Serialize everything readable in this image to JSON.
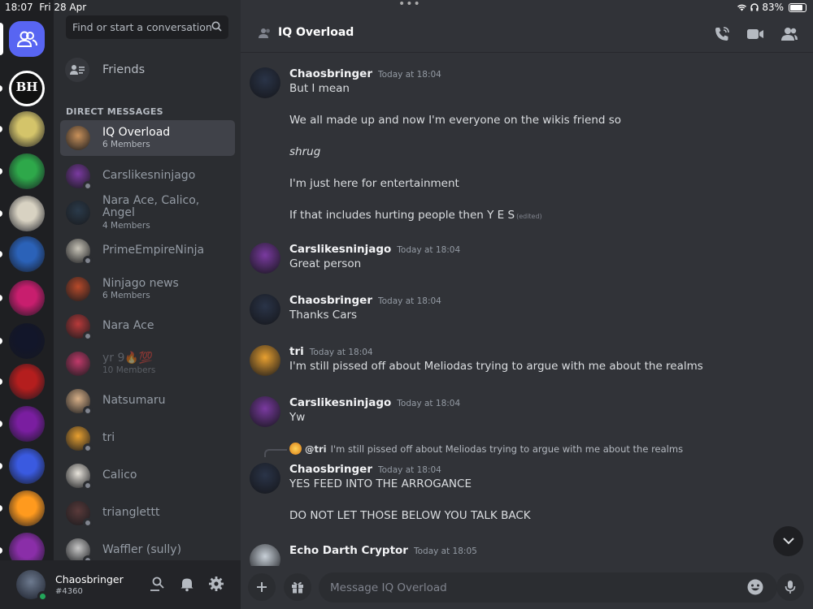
{
  "status_bar": {
    "time": "18:07",
    "date": "Fri 28 Apr",
    "battery": "83%",
    "battery_fraction": 0.83
  },
  "servers": [
    {
      "name": "server-bh",
      "color": "#ffffff"
    },
    {
      "name": "server-2",
      "color": "#d4c46a"
    },
    {
      "name": "server-3",
      "color": "#2ea84a"
    },
    {
      "name": "server-4",
      "color": "#d8d2c2"
    },
    {
      "name": "server-5",
      "color": "#2b62b8"
    },
    {
      "name": "server-6",
      "color": "#c81e6e"
    },
    {
      "name": "server-7",
      "color": "#12162a"
    },
    {
      "name": "server-8",
      "color": "#b41e1e"
    },
    {
      "name": "server-9",
      "color": "#7a1ea0"
    },
    {
      "name": "server-10",
      "color": "#3a5ae0"
    },
    {
      "name": "server-11",
      "color": "#ff9a1e"
    },
    {
      "name": "server-12",
      "color": "#8a2ea8"
    }
  ],
  "bh_label": "BH",
  "search": {
    "placeholder": "Find or start a conversation"
  },
  "friends_label": "Friends",
  "dm_header": "DIRECT MESSAGES",
  "dms": [
    {
      "name": "IQ Overload",
      "sub": "6 Members",
      "active": true,
      "color": "#c9915a"
    },
    {
      "name": "Carslikesninjago",
      "sub": "",
      "color": "#7a3aa0"
    },
    {
      "name": "Nara Ace, Calico, Angel",
      "sub": "4 Members",
      "color": "#2a3a4a"
    },
    {
      "name": "PrimeEmpireNinja",
      "sub": "",
      "color": "#c8c4b8"
    },
    {
      "name": "Ninjago news",
      "sub": "6 Members",
      "color": "#b84a2a"
    },
    {
      "name": "Nara Ace",
      "sub": "",
      "color": "#b83a3a"
    },
    {
      "name": "yr 9🔥💯",
      "sub": "10 Members",
      "dim": true,
      "color": "#c03a6a"
    },
    {
      "name": "Natsumaru",
      "sub": "",
      "color": "#d8b088"
    },
    {
      "name": "tri",
      "sub": "",
      "color": "#e8a030"
    },
    {
      "name": "Calico",
      "sub": "",
      "color": "#e8e4dc"
    },
    {
      "name": "trianglettt",
      "sub": "",
      "color": "#5a3a3a"
    },
    {
      "name": "Waffler (sully)",
      "sub": "",
      "color": "#c8c8c8"
    }
  ],
  "user": {
    "name": "Chaosbringer",
    "tag": "#4360"
  },
  "chat": {
    "title": "IQ Overload",
    "input_placeholder": "Message IQ Overload",
    "edited": "(edited)",
    "messages": [
      {
        "author": "Chaosbringer",
        "time": "Today at 18:04",
        "avatar": "#2a3448",
        "lines": [
          "But I mean",
          "We all made up and now I'm everyone on the wikis friend so",
          "shrug",
          "I'm just here for entertainment",
          "If that includes hurting people then Y E S"
        ]
      },
      {
        "author": "Carslikesninjago",
        "time": "Today at 18:04",
        "avatar": "#7a3aa0",
        "lines": [
          "Great person"
        ]
      },
      {
        "author": "Chaosbringer",
        "time": "Today at 18:04",
        "avatar": "#2a3448",
        "lines": [
          "Thanks Cars"
        ]
      },
      {
        "author": "tri",
        "time": "Today at 18:04",
        "avatar": "#e8a030",
        "lines": [
          "I'm still pissed off about Meliodas trying to argue with me about the realms"
        ]
      },
      {
        "author": "Carslikesninjago",
        "time": "Today at 18:04",
        "avatar": "#7a3aa0",
        "lines": [
          "Yw"
        ]
      },
      {
        "author": "Chaosbringer",
        "time": "Today at 18:04",
        "avatar": "#2a3448",
        "reply": {
          "user": "@tri",
          "text": "I'm still pissed off about Meliodas trying to argue with me about the realms"
        },
        "lines": [
          "YES FEED INTO THE ARROGANCE",
          "DO NOT LET THOSE BELOW YOU TALK BACK"
        ]
      },
      {
        "author": "Echo Darth Cryptor",
        "time": "Today at 18:05",
        "avatar": "#c8d0d8",
        "lines": []
      }
    ]
  }
}
